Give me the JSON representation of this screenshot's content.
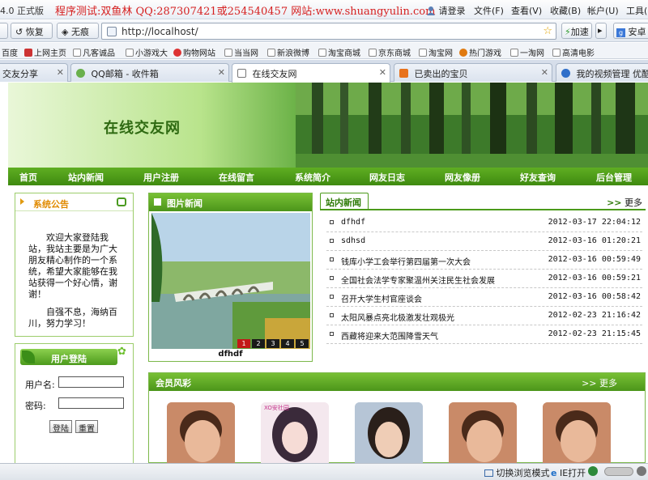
{
  "browser": {
    "version_label": "4.0 正式版",
    "banner": "程序测试:双鱼林 QQ:287307421或254540457 网站:www.shuangyulin.com",
    "menu": [
      "请登录",
      "文件(F)",
      "查看(V)",
      "收藏(B)",
      "帐户(U)",
      "工具("
    ],
    "nav": {
      "back": "恢复",
      "trace": "无痕",
      "url": "http://localhost/",
      "accelerate": "加速",
      "engine": "安卓"
    },
    "favorites": [
      "百度",
      "上网主页",
      "凡客诚品",
      "小游戏大",
      "购物网站",
      "当当网",
      "新浪微博",
      "淘宝商城",
      "京东商城",
      "淘宝网",
      "热门游戏",
      "一淘网",
      "高清电影"
    ],
    "tabs": [
      {
        "label": "交友分享",
        "active": false
      },
      {
        "label": "QQ邮箱 - 收件箱",
        "active": false
      },
      {
        "label": "在线交友网",
        "active": true
      },
      {
        "label": "已卖出的宝贝",
        "active": false
      },
      {
        "label": "我的视频管理 优酷视频",
        "active": false
      }
    ],
    "status": {
      "mode": "切换浏览模式",
      "ie": "IE打开"
    }
  },
  "site": {
    "title": "在线交友网",
    "nav": [
      "首页",
      "站内新闻",
      "用户注册",
      "在线留言",
      "系统简介",
      "网友日志",
      "网友像册",
      "好友查询",
      "后台管理"
    ],
    "notice": {
      "title": "系统公告",
      "paragraphs": [
        "欢迎大家登陆我站，我站主要是为广大朋友精心制作的一个系统，希望大家能够在我站获得一个好心情，谢谢！",
        "自强不息，海纳百川，努力学习！"
      ]
    },
    "login": {
      "title": "用户登陆",
      "username_label": "用户名:",
      "password_label": "密码:",
      "login_button": "登陆",
      "reset_button": "重置"
    },
    "pic_news": {
      "title": "图片新闻",
      "caption": "dfhdf",
      "pages": [
        "1",
        "2",
        "3",
        "4",
        "5"
      ],
      "current_page": 1
    },
    "news": {
      "title": "站内新闻",
      "more": "更多",
      "items": [
        {
          "title": "dfhdf",
          "date": "2012-03-17 22:04:12"
        },
        {
          "title": "sdhsd",
          "date": "2012-03-16 01:20:21"
        },
        {
          "title": "钱库小学工会举行第四届第一次大会",
          "date": "2012-03-16 00:59:49"
        },
        {
          "title": "全国社会法学专家聚温州关注民生社会发展",
          "date": "2012-03-16 00:59:21"
        },
        {
          "title": "召开大学生村官座谈会",
          "date": "2012-03-16 00:58:42"
        },
        {
          "title": "太阳风暴点亮北极激发壮观极光",
          "date": "2012-02-23 21:16:42"
        },
        {
          "title": "西藏将迎来大范围降雪天气",
          "date": "2012-02-23 21:15:45"
        }
      ]
    },
    "members": {
      "title": "会员风彩",
      "more": "更多",
      "photo_badge": "XO安社园"
    }
  },
  "colors": {
    "brand_green": "#4c951a",
    "banner_red": "#d62020",
    "notice_orange": "#e08a00"
  }
}
